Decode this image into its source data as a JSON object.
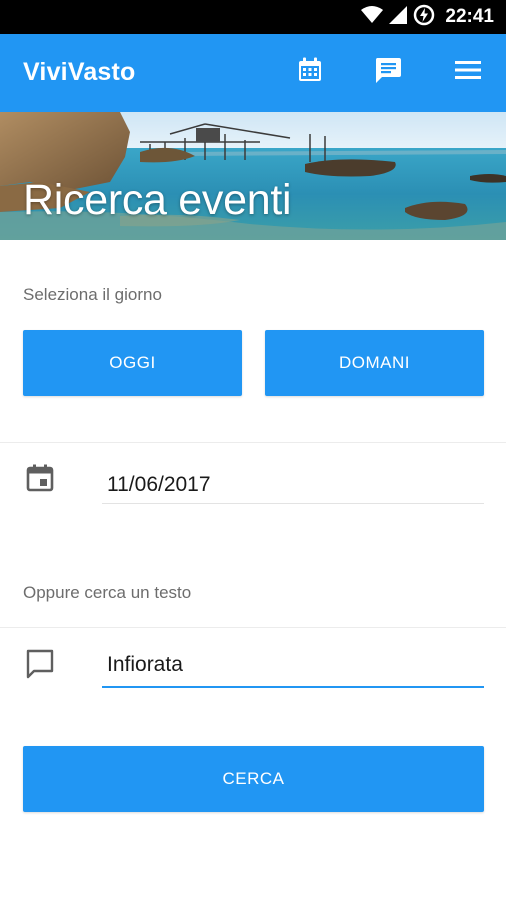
{
  "status_bar": {
    "time": "22:41"
  },
  "app_bar": {
    "title": "ViviVasto",
    "actions": [
      "calendar-icon",
      "chat-icon",
      "menu-icon"
    ]
  },
  "hero": {
    "title": "Ricerca eventi"
  },
  "day_section": {
    "label": "Seleziona il giorno",
    "today_button": "OGGI",
    "tomorrow_button": "DOMANI"
  },
  "date_field": {
    "value": "11/06/2017"
  },
  "text_section": {
    "label": "Oppure cerca un testo"
  },
  "search_field": {
    "value": "Infiorata"
  },
  "search_button": "CERCA",
  "colors": {
    "accent": "#2196F3",
    "status_bar": "#000000"
  }
}
